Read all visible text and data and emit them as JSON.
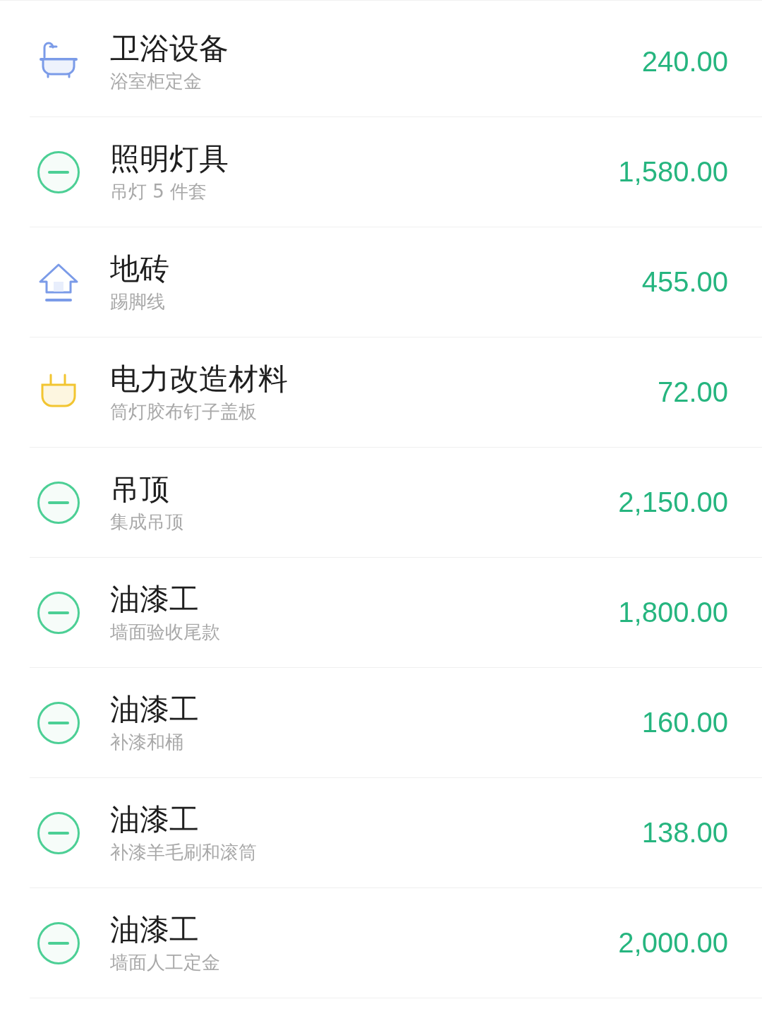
{
  "entries": [
    {
      "kind": "bathtub",
      "title": "卫浴设备",
      "note": "浴室柜定金",
      "amount": "240.00"
    },
    {
      "kind": "minus",
      "title": "照明灯具",
      "note": "吊灯 5 件套",
      "amount": "1,580.00"
    },
    {
      "kind": "house",
      "title": "地砖",
      "note": "踢脚线",
      "amount": "455.00"
    },
    {
      "kind": "plug",
      "title": "电力改造材料",
      "note": "筒灯胶布钉子盖板",
      "amount": "72.00"
    },
    {
      "kind": "minus",
      "title": "吊顶",
      "note": "集成吊顶",
      "amount": "2,150.00"
    },
    {
      "kind": "minus",
      "title": "油漆工",
      "note": "墙面验收尾款",
      "amount": "1,800.00"
    },
    {
      "kind": "minus",
      "title": "油漆工",
      "note": "补漆和桶",
      "amount": "160.00"
    },
    {
      "kind": "minus",
      "title": "油漆工",
      "note": "补漆羊毛刷和滚筒",
      "amount": "138.00"
    },
    {
      "kind": "minus",
      "title": "油漆工",
      "note": "墙面人工定金",
      "amount": "2,000.00"
    }
  ]
}
